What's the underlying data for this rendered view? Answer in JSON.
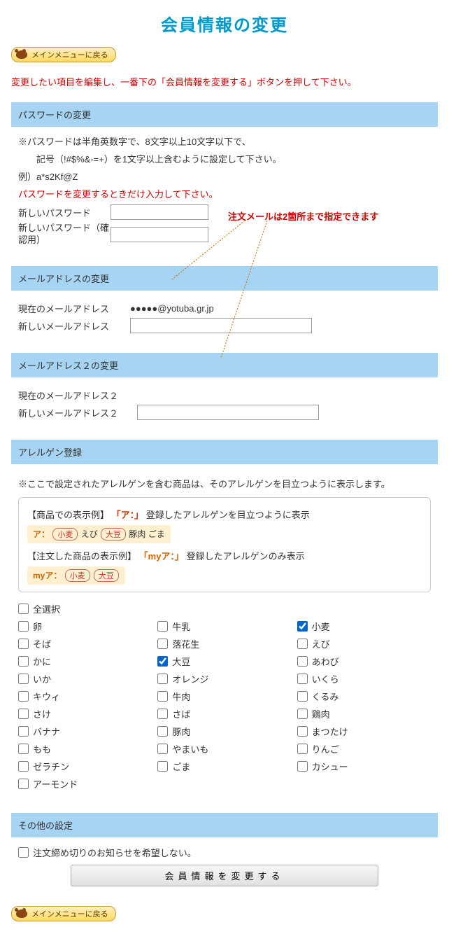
{
  "page_title": "会員情報の変更",
  "menu_return": "メインメニューに戻る",
  "instruction": "変更したい項目を編集し、一番下の「会員情報を変更する」ボタンを押して下さい。",
  "callout_text": "注文メールは2箇所まで指定できます",
  "sections": {
    "password": {
      "header": "パスワードの変更",
      "note1": "※パスワードは半角英数字で、8文字以上10文字以下で、",
      "note2": "　　記号（!#$%&-=+）を1文字以上含むように設定して下さい。",
      "note3": "例）a*s2Kf@Z",
      "note_red": "パスワードを変更するときだけ入力して下さい。",
      "label_new": "新しいパスワード",
      "label_confirm": "新しいパスワード（確認用）"
    },
    "email1": {
      "header": "メールアドレスの変更",
      "label_current": "現在のメールアドレス",
      "current_value": "●●●●●@yotuba.gr.jp",
      "label_new": "新しいメールアドレス"
    },
    "email2": {
      "header": "メールアドレス２の変更",
      "label_current": "現在のメールアドレス２",
      "label_new": "新しいメールアドレス２"
    },
    "allergen": {
      "header": "アレルゲン登録",
      "note": "※ここで設定されたアレルゲンを含む商品は、そのアレルゲンを目立つように表示します。",
      "ex1_prefix": "【商品での表示例】",
      "ex1_label": "「ア：」",
      "ex1_text": "登録したアレルゲンを目立つように表示",
      "ex1_tag_prefix": "ア：",
      "ex1_tags_highlighted": [
        "小麦",
        "大豆"
      ],
      "ex1_tags_plain": "えび",
      "ex1_tags_suffix": "豚肉 ごま",
      "ex2_prefix": "【注文した商品の表示例】",
      "ex2_label": "「myア：」",
      "ex2_text": "登録したアレルゲンのみ表示",
      "ex2_tag_prefix": "myア：",
      "ex2_tags": [
        "小麦",
        "大豆"
      ],
      "select_all": "全選択",
      "items": [
        {
          "label": "卵",
          "checked": false
        },
        {
          "label": "牛乳",
          "checked": false
        },
        {
          "label": "小麦",
          "checked": true
        },
        {
          "label": "そば",
          "checked": false
        },
        {
          "label": "落花生",
          "checked": false
        },
        {
          "label": "えび",
          "checked": false
        },
        {
          "label": "かに",
          "checked": false
        },
        {
          "label": "大豆",
          "checked": true
        },
        {
          "label": "あわび",
          "checked": false
        },
        {
          "label": "いか",
          "checked": false
        },
        {
          "label": "オレンジ",
          "checked": false
        },
        {
          "label": "いくら",
          "checked": false
        },
        {
          "label": "キウィ",
          "checked": false
        },
        {
          "label": "牛肉",
          "checked": false
        },
        {
          "label": "くるみ",
          "checked": false
        },
        {
          "label": "さけ",
          "checked": false
        },
        {
          "label": "さば",
          "checked": false
        },
        {
          "label": "鶏肉",
          "checked": false
        },
        {
          "label": "バナナ",
          "checked": false
        },
        {
          "label": "豚肉",
          "checked": false
        },
        {
          "label": "まつたけ",
          "checked": false
        },
        {
          "label": "もも",
          "checked": false
        },
        {
          "label": "やまいも",
          "checked": false
        },
        {
          "label": "りんご",
          "checked": false
        },
        {
          "label": "ゼラチン",
          "checked": false
        },
        {
          "label": "ごま",
          "checked": false
        },
        {
          "label": "カシュー",
          "checked": false
        },
        {
          "label": "アーモンド",
          "checked": false
        }
      ]
    },
    "other": {
      "header": "その他の設定",
      "checkbox_label": "注文締め切りのお知らせを希望しない。"
    }
  },
  "submit_label": "会員情報を変更する"
}
